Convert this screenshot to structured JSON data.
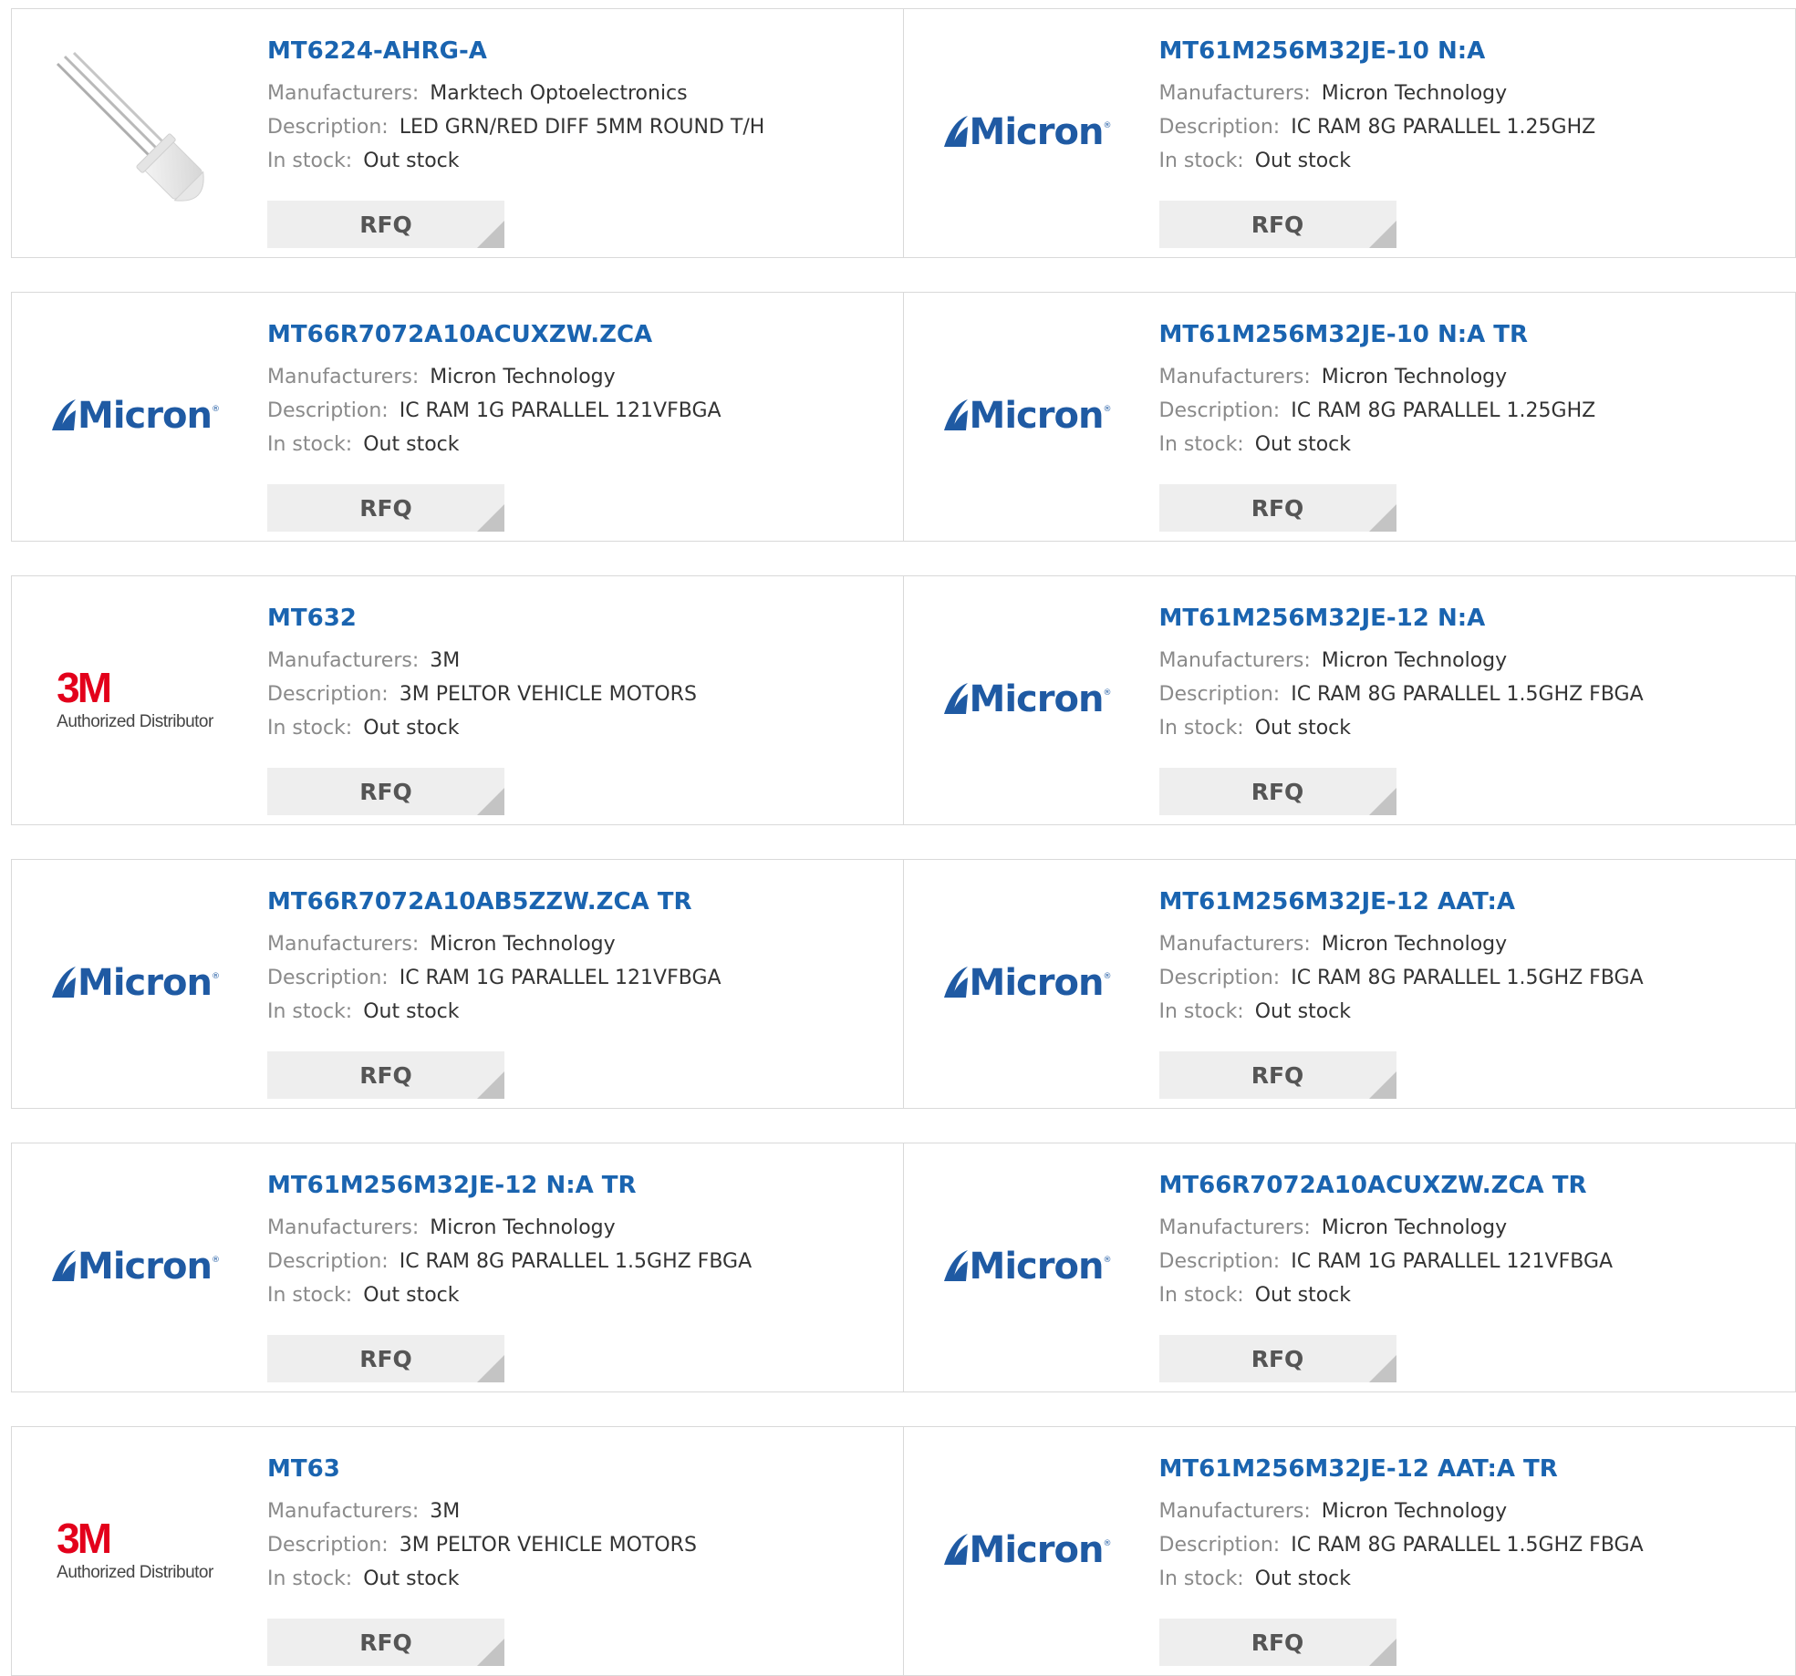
{
  "labels": {
    "manufacturers": "Manufacturers:",
    "description": "Description:",
    "in_stock": "In stock:"
  },
  "rfq_label": "RFQ",
  "logo_text": {
    "micron": "Micron",
    "three_m": "3M",
    "three_m_sub": "Authorized Distributor"
  },
  "colors": {
    "link": "#1a64b0",
    "micron_blue": "#1f5aa3",
    "three_m_red": "#e3001b",
    "rfq_bg": "#eeeeee"
  },
  "products": [
    {
      "part": "MT6224-AHRG-A",
      "manufacturer": "Marktech Optoelectronics",
      "description": "LED GRN/RED DIFF 5MM ROUND T/H",
      "stock": "Out stock",
      "image": "led-component"
    },
    {
      "part": "MT61M256M32JE-10 N:A",
      "manufacturer": "Micron Technology",
      "description": "IC RAM 8G PARALLEL 1.25GHZ",
      "stock": "Out stock",
      "image": "micron-logo"
    },
    {
      "part": "MT66R7072A10ACUXZW.ZCA",
      "manufacturer": "Micron Technology",
      "description": "IC RAM 1G PARALLEL 121VFBGA",
      "stock": "Out stock",
      "image": "micron-logo"
    },
    {
      "part": "MT61M256M32JE-10 N:A TR",
      "manufacturer": "Micron Technology",
      "description": "IC RAM 8G PARALLEL 1.25GHZ",
      "stock": "Out stock",
      "image": "micron-logo"
    },
    {
      "part": "MT632",
      "manufacturer": "3M",
      "description": "3M PELTOR VEHICLE MOTORS",
      "stock": "Out stock",
      "image": "3m-logo"
    },
    {
      "part": "MT61M256M32JE-12 N:A",
      "manufacturer": "Micron Technology",
      "description": "IC RAM 8G PARALLEL 1.5GHZ FBGA",
      "stock": "Out stock",
      "image": "micron-logo"
    },
    {
      "part": "MT66R7072A10AB5ZZW.ZCA TR",
      "manufacturer": "Micron Technology",
      "description": "IC RAM 1G PARALLEL 121VFBGA",
      "stock": "Out stock",
      "image": "micron-logo"
    },
    {
      "part": "MT61M256M32JE-12 AAT:A",
      "manufacturer": "Micron Technology",
      "description": "IC RAM 8G PARALLEL 1.5GHZ FBGA",
      "stock": "Out stock",
      "image": "micron-logo"
    },
    {
      "part": "MT61M256M32JE-12 N:A TR",
      "manufacturer": "Micron Technology",
      "description": "IC RAM 8G PARALLEL 1.5GHZ FBGA",
      "stock": "Out stock",
      "image": "micron-logo"
    },
    {
      "part": "MT66R7072A10ACUXZW.ZCA TR",
      "manufacturer": "Micron Technology",
      "description": "IC RAM 1G PARALLEL 121VFBGA",
      "stock": "Out stock",
      "image": "micron-logo"
    },
    {
      "part": "MT63",
      "manufacturer": "3M",
      "description": "3M PELTOR VEHICLE MOTORS",
      "stock": "Out stock",
      "image": "3m-logo"
    },
    {
      "part": "MT61M256M32JE-12 AAT:A TR",
      "manufacturer": "Micron Technology",
      "description": "IC RAM 8G PARALLEL 1.5GHZ FBGA",
      "stock": "Out stock",
      "image": "micron-logo"
    }
  ]
}
